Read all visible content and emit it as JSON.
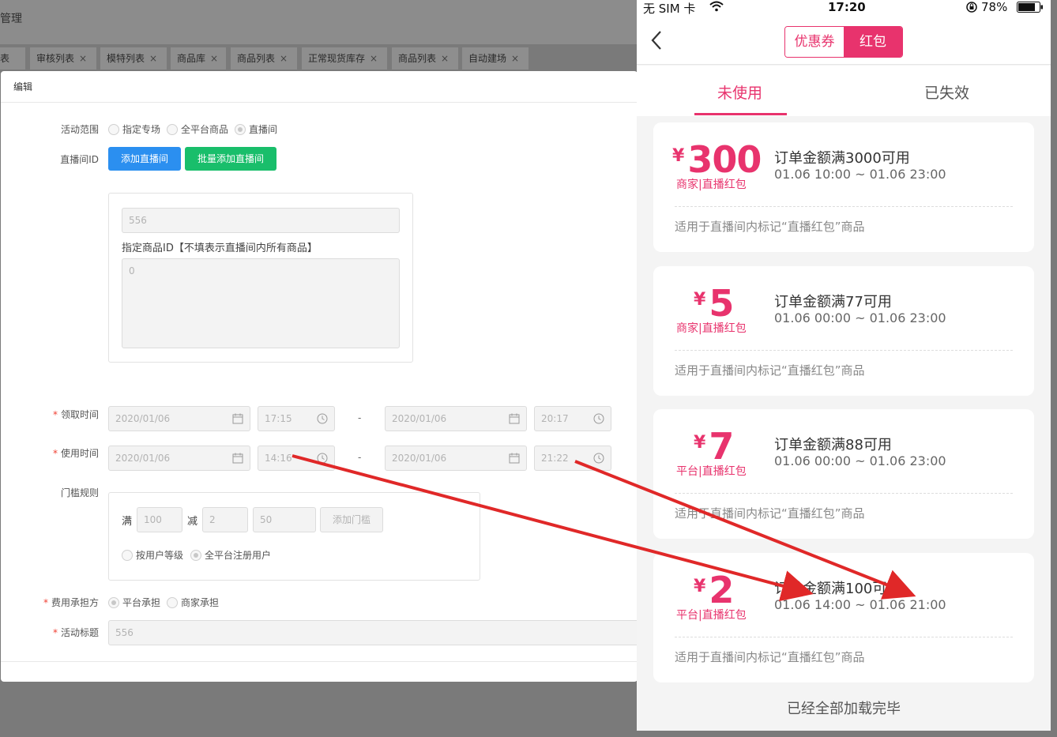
{
  "admin": {
    "header_title": "管理",
    "tabs": [
      {
        "label": "表"
      },
      {
        "label": "审核列表"
      },
      {
        "label": "模特列表"
      },
      {
        "label": "商品库"
      },
      {
        "label": "商品列表"
      },
      {
        "label": "正常现货库存"
      },
      {
        "label": "商品列表"
      },
      {
        "label": "自动建场"
      }
    ],
    "tab_close": "×"
  },
  "modal": {
    "title": "编辑",
    "scope_label": "活动范围",
    "scope_options": [
      "指定专场",
      "全平台商品",
      "直播间"
    ],
    "room_id_label": "直播间ID",
    "add_room_button": "添加直播间",
    "batch_add_room_button": "批量添加直播间",
    "room_id_value": "556",
    "goods_id_label": "指定商品ID【不填表示直播间内所有商品】",
    "goods_id_value": "0",
    "required_mark": "*",
    "receive_time_label": "领取时间",
    "receive_start_date": "2020/01/06",
    "receive_start_time": "17:15",
    "receive_end_date": "2020/01/06",
    "receive_end_time": "20:17",
    "use_time_label": "使用时间",
    "use_start_date": "2020/01/06",
    "use_start_time": "14:16",
    "use_end_date": "2020/01/06",
    "use_end_time": "21:22",
    "range_sep": "-",
    "threshold_label": "门槛规则",
    "full_label": "满",
    "full_value": "100",
    "minus_label": "减",
    "minus_value": "2",
    "minus_value2": "50",
    "add_threshold_button": "添加门槛",
    "user_scope_options": [
      "按用户等级",
      "全平台注册用户"
    ],
    "cost_label": "费用承担方",
    "cost_options": [
      "平台承担",
      "商家承担"
    ],
    "activity_title_label": "活动标题",
    "activity_title_value": "556"
  },
  "phone": {
    "status_carrier": "无 SIM 卡",
    "status_time": "17:20",
    "status_battery": "78%",
    "seg_coupon": "优惠券",
    "seg_redpacket": "红包",
    "tab_unused": "未使用",
    "tab_expired": "已失效",
    "yen": "¥",
    "cards": [
      {
        "amount": "300",
        "type": "商家|直播红包",
        "condition": "订单金额满3000可用",
        "period": "01.06 10:00 ~ 01.06 23:00",
        "desc": "适用于直播间内标记“直播红包”商品"
      },
      {
        "amount": "5",
        "type": "商家|直播红包",
        "condition": "订单金额满77可用",
        "period": "01.06 00:00 ~ 01.06 23:00",
        "desc": "适用于直播间内标记“直播红包”商品"
      },
      {
        "amount": "7",
        "type": "平台|直播红包",
        "condition": "订单金额满88可用",
        "period": "01.06 00:00 ~ 01.06 23:00",
        "desc": "适用于直播间内标记“直播红包”商品"
      },
      {
        "amount": "2",
        "type": "平台|直播红包",
        "condition": "订单金额满100可用",
        "period": "01.06 14:00 ~ 01.06 21:00",
        "desc": "适用于直播间内标记“直播红包”商品"
      }
    ],
    "loaded_all": "已经全部加载完毕"
  },
  "colors": {
    "accent_pink": "#e8336d",
    "blue_button": "#2b8ff0",
    "green_button": "#19be6b",
    "arrow_red": "#e02828"
  }
}
